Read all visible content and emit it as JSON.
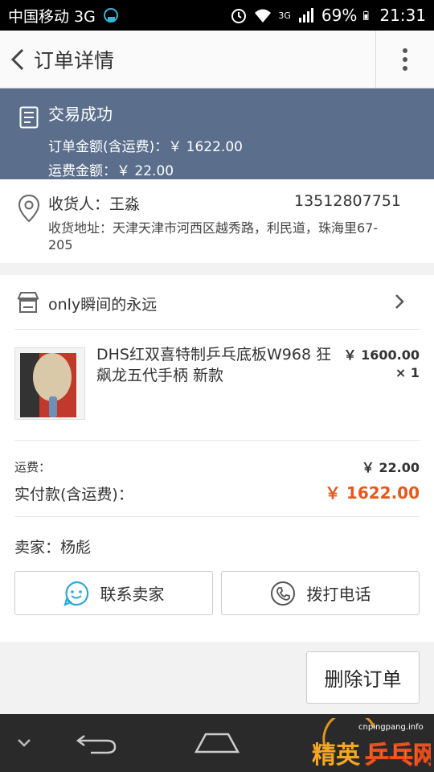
{
  "status_bar": {
    "carrier": "中国移动 3G",
    "network": "3G",
    "battery": "69%",
    "time": "21:31"
  },
  "header": {
    "title": "订单详情",
    "back_icon": "chevron-left-icon",
    "menu_icon": "more-vertical-icon"
  },
  "order_status": {
    "status": "交易成功",
    "order_amount": "订单金额(含运费)：￥ 1622.00",
    "shipping_amount": "运费金额：￥ 22.00"
  },
  "address": {
    "receiver": "收货人：王淼",
    "phone": "13512807751",
    "address": "收货地址：天津天津市河西区越秀路，利民道，珠海里67-205"
  },
  "store": {
    "name": "only瞬间的永远"
  },
  "item": {
    "title": "DHS红双喜特制乒乓底板W968 狂飙龙五代手柄 新款",
    "price": "￥ 1600.00",
    "qty": "× 1"
  },
  "fees": {
    "shipping_label": "运费：",
    "shipping_value": "￥ 22.00",
    "paid_label": "实付款(含运费)：",
    "paid_value": "￥ 1622.00"
  },
  "seller": "卖家：杨彪",
  "buttons": {
    "contact": "联系卖家",
    "call": "拨打电话",
    "delete": "删除订单"
  },
  "watermark": {
    "site": "cnpingpang.info",
    "text": "精英乒乓网"
  },
  "colors": {
    "banner": "#5b6f8c",
    "accent_price": "#e8571d"
  }
}
